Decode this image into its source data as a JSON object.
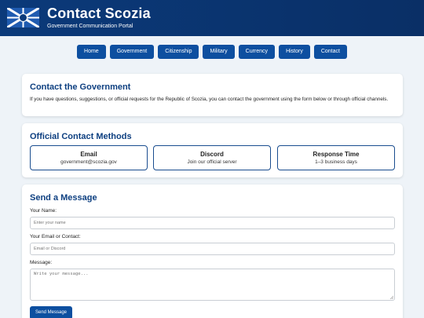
{
  "header": {
    "title": "Contact Scozia",
    "subtitle": "Government Communication Portal",
    "flag_icon": "scozia-flag-icon"
  },
  "nav": {
    "items": [
      "Home",
      "Government",
      "Citizenship",
      "Military",
      "Currency",
      "History",
      "Contact"
    ]
  },
  "intro": {
    "heading": "Contact the Government",
    "text": "If you have questions, suggestions, or official requests for the Republic of Scozia, you can contact the government using the form below or through official channels."
  },
  "methods": {
    "heading": "Official Contact Methods",
    "items": [
      {
        "title": "Email",
        "value": "government@scozia.gov"
      },
      {
        "title": "Discord",
        "value": "Join our official server"
      },
      {
        "title": "Response Time",
        "value": "1–3 business days"
      }
    ]
  },
  "form": {
    "heading": "Send a Message",
    "name_label": "Your Name:",
    "name_placeholder": "Enter your name",
    "contact_label": "Your Email or Contact:",
    "contact_placeholder": "Email or Discord",
    "message_label": "Message:",
    "message_placeholder": "Write your message...",
    "submit_label": "Send Message"
  },
  "colors": {
    "header_bg": "#0b3a7a",
    "accent": "#0d4fa0",
    "heading": "#0d3f80",
    "page_bg": "#eef3f8"
  }
}
